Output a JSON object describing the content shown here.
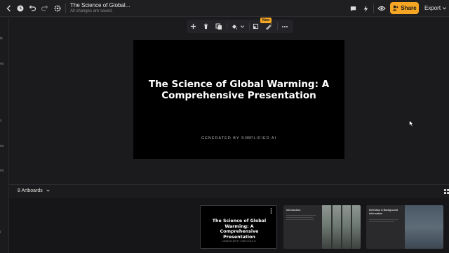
{
  "topbar": {
    "title": "The Science of Global...",
    "status": "All changes are saved.",
    "share_label": "Share",
    "export_label": "Export",
    "icons": [
      "back-icon",
      "history-icon",
      "undo-icon",
      "redo-icon",
      "settings-icon",
      "comment-icon",
      "lightning-icon",
      "preview-icon",
      "user-plus-icon",
      "chevron-down-icon"
    ]
  },
  "left_rail": {
    "fragments": [
      "ts",
      "es",
      "",
      "",
      "s",
      "es",
      "l"
    ]
  },
  "float_toolbar": {
    "icons": [
      "add-icon",
      "delete-icon",
      "duplicate-icon",
      "fill-icon",
      "chevron-down-icon",
      "crop-icon",
      "magic-icon",
      "more-icon"
    ],
    "new_badge": "New"
  },
  "canvas": {
    "title": "The Science of Global Warming: A Comprehensive Presentation",
    "subtitle": "GENERATED BY SIMPLIFIED AI"
  },
  "artboards": {
    "label": "8 Artboards",
    "thumbnails": [
      {
        "title": "The Science of Global Warming: A Comprehensive Presentation",
        "subtitle": "GENERATED BY SIMPLIFIED AI"
      },
      {
        "title": "Introduction"
      },
      {
        "title": "Definition & Background Information"
      }
    ]
  },
  "colors": {
    "accent": "#f5a524",
    "bg": "#1b1b1d",
    "canvas": "#000000"
  }
}
